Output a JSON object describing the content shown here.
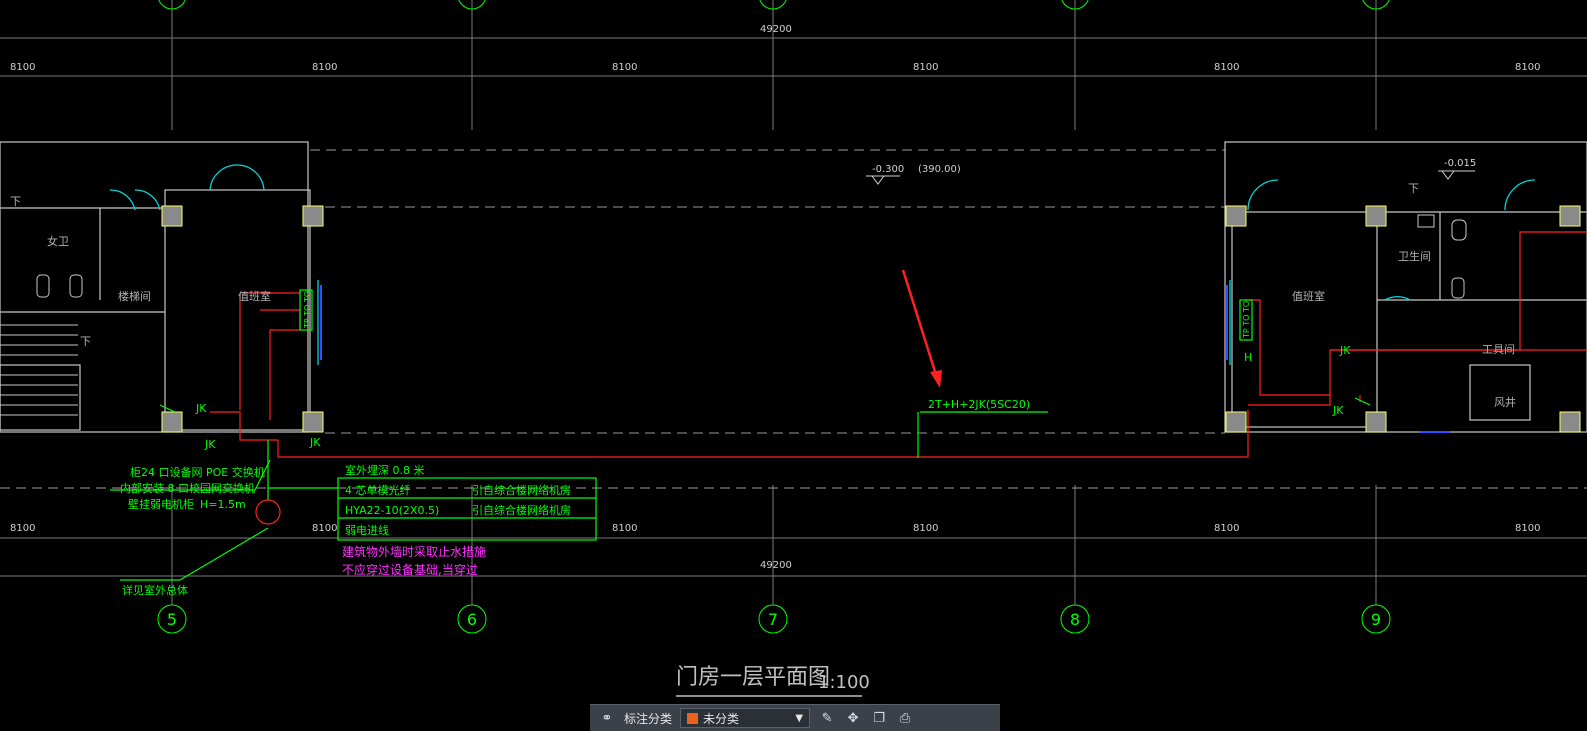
{
  "drawing": {
    "title": "门房一层平面图",
    "scale": "1:100",
    "total_dimension": "49200",
    "bay_dimension": "8100",
    "axis_labels": [
      "5",
      "6",
      "7",
      "8",
      "9"
    ],
    "levels": {
      "center": "-0.300",
      "center_abs": "(390.00)",
      "right": "-0.015"
    },
    "rooms": {
      "female_toilet": "女卫",
      "stair": "楼梯间",
      "duty_left": "值班室",
      "duty_right": "值班室",
      "toilet": "卫生间",
      "tool_room": "工具间",
      "wind_shaft": "风井"
    },
    "stair_down": "下",
    "cable_label": "2T+H+2JK(5SC20)",
    "jk": "JK",
    "outlet_label": "TP TO TO",
    "h_label": "H",
    "note_left": {
      "line1": "柜24 口设备网  POE 交换机",
      "line2": "内部安装  8 口校园网交换机",
      "line3": "壁挂弱电机柜",
      "height": "H=1.5m"
    },
    "note_bottom": "详见室外总体",
    "legend_table": {
      "header": "室外埋深  0.8  米",
      "rows": [
        {
          "left": "4 芯单模光纤",
          "right": "引自综合楼网络机房"
        },
        {
          "left": "HYA22-10(2X0.5)",
          "right": "引自综合楼网络机房"
        },
        {
          "left": "弱电进线",
          "right": ""
        }
      ]
    },
    "magenta_note": {
      "line1": "建筑物外墙时采取止水措施",
      "line2": "不应穿过设备基础,当穿过"
    }
  },
  "toolbar": {
    "label": "标注分类",
    "select_value": "未分类",
    "swatch_color": "#e8631c"
  },
  "colors": {
    "grid": "#8c8c8c",
    "wall": "#c8c8c8",
    "cyan": "#00e0e0",
    "red": "#ff2020",
    "green": "#00ff00",
    "magenta": "#ff30ff",
    "column": "#8a8a8a"
  }
}
